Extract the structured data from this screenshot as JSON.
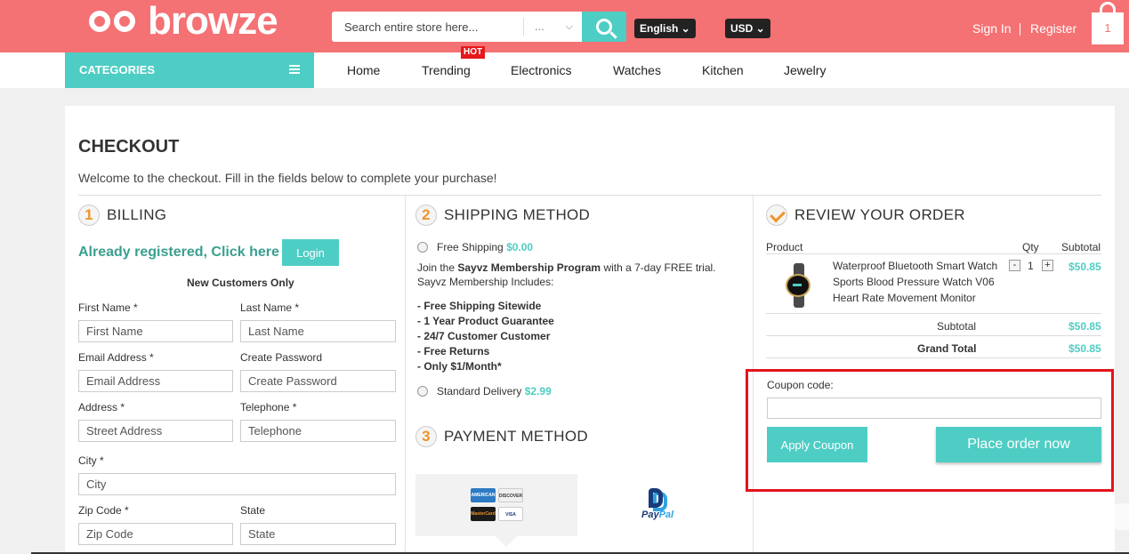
{
  "header": {
    "logo_text": "browze",
    "search_placeholder": "Search entire store here...",
    "search_category": "...",
    "language": "English",
    "currency": "USD",
    "sign_in": "Sign In",
    "register": "Register",
    "cart_count": "1"
  },
  "nav": {
    "categories": "CATEGORIES",
    "links": [
      "Home",
      "Trending",
      "Electronics",
      "Watches",
      "Kitchen",
      "Jewelry"
    ],
    "hot_badge": "HOT"
  },
  "checkout": {
    "title": "CHECKOUT",
    "welcome": "Welcome to the checkout. Fill in the fields below to complete your purchase!"
  },
  "billing": {
    "step": "1",
    "title": "BILLING",
    "registered": "Already registered, Click here",
    "login": "Login",
    "new_customers": "New Customers Only",
    "fields": {
      "first_name_label": "First Name *",
      "first_name_ph": "First Name",
      "last_name_label": "Last Name *",
      "last_name_ph": "Last Name",
      "email_label": "Email Address *",
      "email_ph": "Email Address",
      "password_label": "Create Password",
      "password_ph": "Create Password",
      "address_label": "Address *",
      "address_ph": "Street Address",
      "telephone_label": "Telephone *",
      "telephone_ph": "Telephone",
      "city_label": "City *",
      "city_ph": "City",
      "zip_label": "Zip Code *",
      "zip_ph": "Zip Code",
      "state_label": "State",
      "state_ph": "State"
    }
  },
  "shipping": {
    "step": "2",
    "title": "SHIPPING METHOD",
    "free_label": "Free Shipping",
    "free_price": "$0.00",
    "join_pre": "Join the",
    "program": "Sayvz Membership Program",
    "join_post": "with a 7-day FREE trial.",
    "includes": "Sayvz Membership Includes:",
    "benefits": [
      "- Free Shipping Sitewide",
      "- 1 Year Product Guarantee",
      "- 24/7 Customer Customer",
      "- Free Returns",
      "- Only $1/Month*"
    ],
    "standard_label": "Standard Delivery",
    "standard_price": "$2.99"
  },
  "payment": {
    "step": "3",
    "title": "PAYMENT METHOD",
    "cards": [
      "AMERICAN EXPRESS",
      "DISCOVER",
      "MasterCard",
      "VISA"
    ],
    "paypal_a": "Pay",
    "paypal_b": "Pal"
  },
  "review": {
    "title": "REVIEW YOUR ORDER",
    "col_product": "Product",
    "col_qty": "Qty",
    "col_subtotal": "Subtotal",
    "product_name": "Waterproof Bluetooth Smart Watch Sports Blood Pressure Watch V06 Heart Rate Movement Monitor",
    "minus": "-",
    "qty": "1",
    "plus": "+",
    "line_total": "$50.85",
    "subtotal_label": "Subtotal",
    "subtotal": "$50.85",
    "grand_total_label": "Grand Total",
    "grand_total": "$50.85",
    "coupon_label": "Coupon code:",
    "apply": "Apply Coupon",
    "place_order": "Place order now"
  },
  "colors": {
    "header": "#f47174",
    "accent": "#4ecdc4",
    "highlight": "#e3141c",
    "step_number": "#f0942a"
  }
}
